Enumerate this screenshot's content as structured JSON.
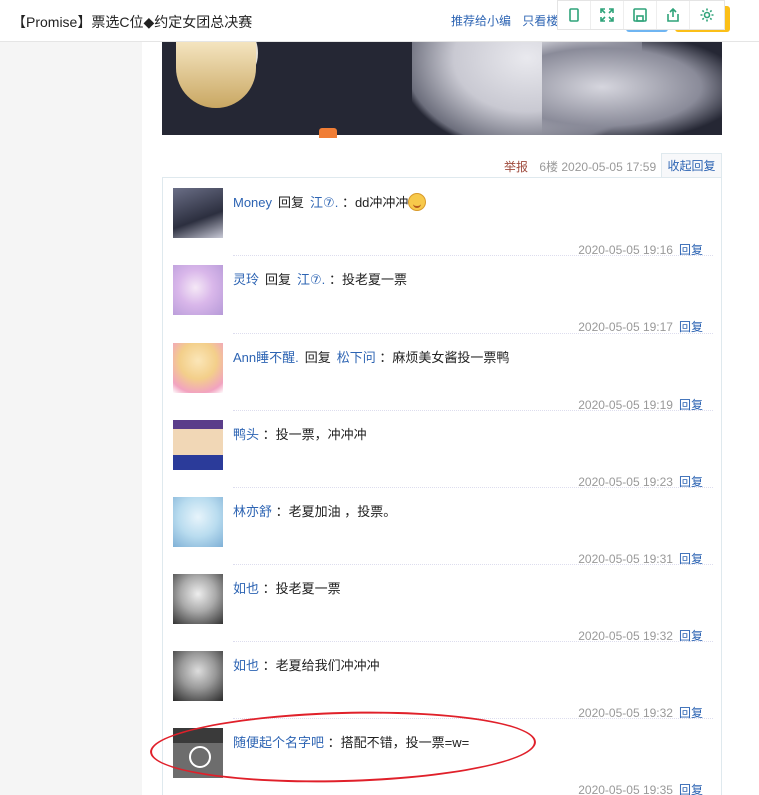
{
  "header": {
    "title": "【Promise】票选C位◆约定女团总决赛",
    "recommend_link": "推荐给小编",
    "only_op_link": "只看楼主"
  },
  "post": {
    "report_label": "举报",
    "floor_time": "6楼 2020-05-05 17:59",
    "collapse_label": "收起回复"
  },
  "replies": [
    {
      "user": "Money",
      "verb": "回复",
      "target": "江⑦.",
      "content": "：dd冲冲冲",
      "has_emoji": true,
      "time": "2020-05-05 19:16",
      "reply_label": "回复"
    },
    {
      "user": "灵玲",
      "verb": "回复",
      "target": "江⑦.",
      "content": "：投老夏一票",
      "time": "2020-05-05 19:17",
      "reply_label": "回复"
    },
    {
      "user": "Ann睡不醒.",
      "verb": "回复",
      "target": "松下问",
      "content": "：麻烦美女酱投一票鸭",
      "time": "2020-05-05 19:19",
      "reply_label": "回复"
    },
    {
      "user": "鸭头",
      "verb": "",
      "target": "",
      "content": "：投一票，冲冲冲",
      "time": "2020-05-05 19:23",
      "reply_label": "回复"
    },
    {
      "user": "林亦舒",
      "verb": "",
      "target": "",
      "content": "：老夏加油 ，投票。",
      "time": "2020-05-05 19:31",
      "reply_label": "回复"
    },
    {
      "user": "如也",
      "verb": "",
      "target": "",
      "content": "：投老夏一票",
      "time": "2020-05-05 19:32",
      "reply_label": "回复"
    },
    {
      "user": "如也",
      "verb": "",
      "target": "",
      "content": "：老夏给我们冲冲冲",
      "time": "2020-05-05 19:32",
      "reply_label": "回复"
    },
    {
      "user": "随便起个名字吧",
      "verb": "",
      "target": "",
      "content": "：搭配不错，投一票=w=",
      "time": "2020-05-05 19:35",
      "reply_label": "回复"
    }
  ],
  "colors": {
    "link": "#2d64b3",
    "highlight": "#e0202a",
    "tool_icon": "#2fa37a"
  },
  "toolbox_icons": [
    "phone-icon",
    "fullscreen-icon",
    "save-icon",
    "share-icon",
    "settings-icon"
  ]
}
